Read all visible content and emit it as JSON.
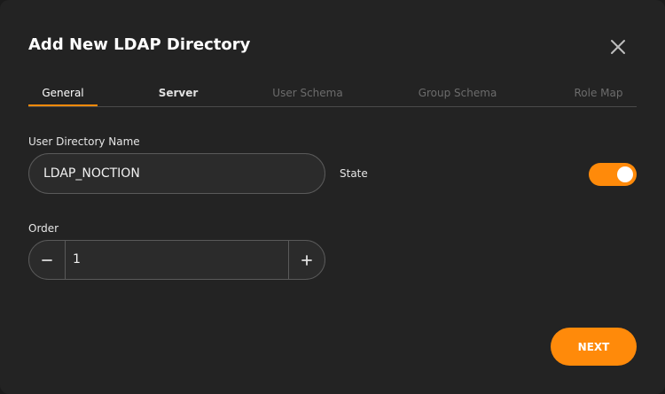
{
  "dialog": {
    "title": "Add New LDAP Directory",
    "close_icon": "close-icon"
  },
  "tabs": [
    {
      "label": "General",
      "state": "active"
    },
    {
      "label": "Server",
      "state": "enabled"
    },
    {
      "label": "User Schema",
      "state": "disabled"
    },
    {
      "label": "Group Schema",
      "state": "disabled"
    },
    {
      "label": "Role Map",
      "state": "disabled"
    }
  ],
  "form": {
    "directory_name_label": "User Directory Name",
    "directory_name_value": "LDAP_NOCTION",
    "state_label": "State",
    "state_on": true,
    "order_label": "Order",
    "order_value": "1",
    "minus_icon": "minus-icon",
    "plus_icon": "plus-icon"
  },
  "footer": {
    "next_label": "NEXT"
  },
  "colors": {
    "accent": "#ff8a0a",
    "background": "#232323"
  }
}
